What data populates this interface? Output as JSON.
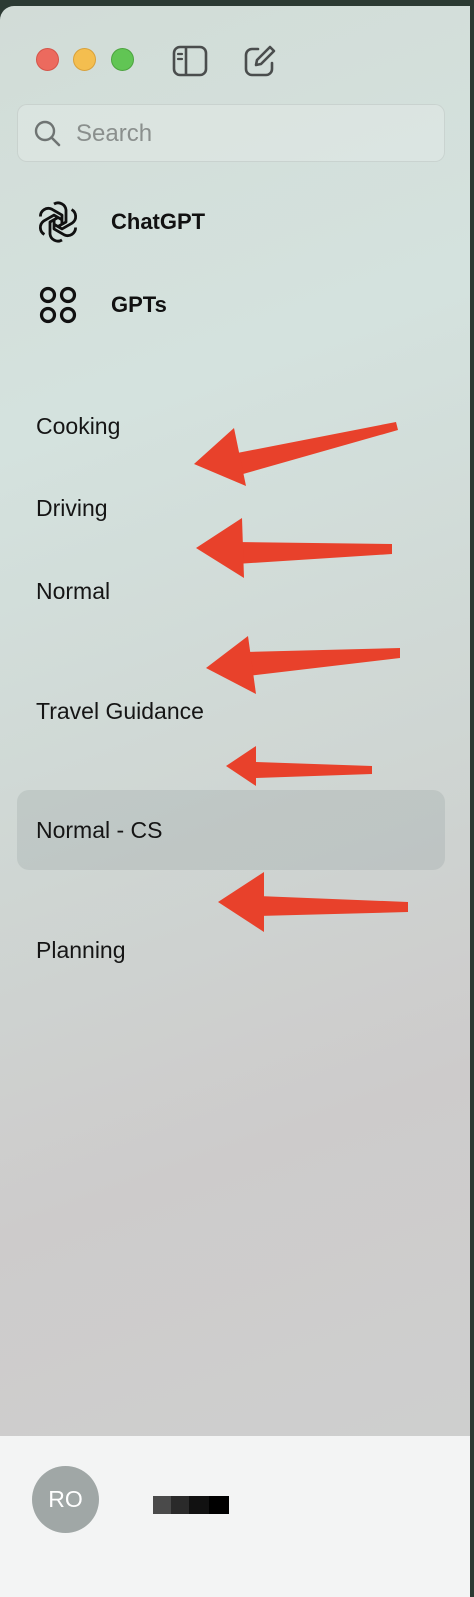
{
  "window": {
    "traffic_lights": [
      "close",
      "minimize",
      "zoom"
    ],
    "toolbar_icons": [
      "sidebar-toggle-icon",
      "new-chat-icon"
    ]
  },
  "search": {
    "placeholder": "Search",
    "value": ""
  },
  "nav": [
    {
      "label": "ChatGPT",
      "icon": "chatgpt-logo-icon"
    },
    {
      "label": "GPTs",
      "icon": "grid-circles-icon"
    }
  ],
  "chats": [
    {
      "label": "Cooking",
      "selected": false
    },
    {
      "label": "Driving",
      "selected": false
    },
    {
      "label": "Normal",
      "selected": false
    },
    {
      "label": "Travel Guidance",
      "selected": false
    },
    {
      "label": "Normal - CS",
      "selected": true
    },
    {
      "label": "Planning",
      "selected": false
    }
  ],
  "annotations": {
    "arrow_color": "#e8412b",
    "arrow_count": 5
  },
  "footer": {
    "avatar_initials": "RO",
    "username_redacted": true
  },
  "colors": {
    "close": "#ec6a5e",
    "minimize": "#f4be4f",
    "zoom": "#61c554",
    "avatar_bg": "#a0a7a6"
  }
}
